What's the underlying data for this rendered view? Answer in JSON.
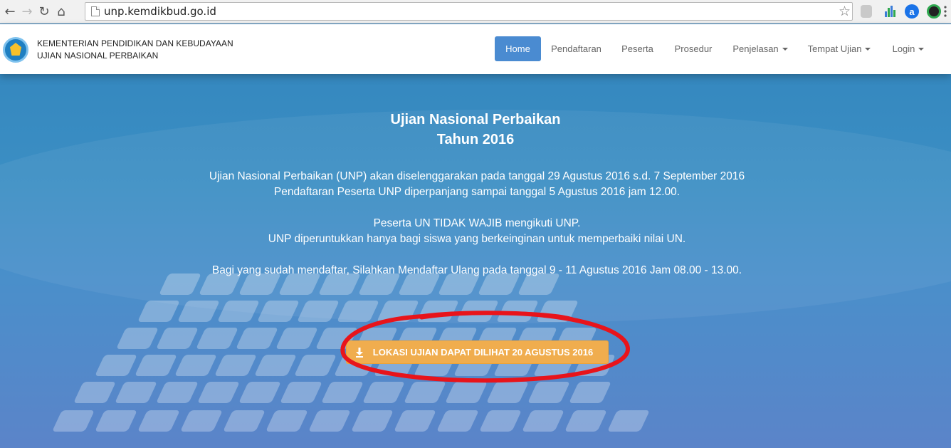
{
  "browser": {
    "url": "unp.kemdikbud.go.id",
    "back_icon": "arrow-left-icon",
    "forward_icon": "arrow-right-icon",
    "reload_icon": "reload-icon",
    "home_icon": "home-icon",
    "bookmark_icon": "star-icon"
  },
  "header": {
    "brand_line1": "KEMENTERIAN PENDIDIKAN DAN KEBUDAYAAN",
    "brand_line2": "UJIAN NASIONAL PERBAIKAN",
    "menu": [
      {
        "label": "Home",
        "active": true,
        "dropdown": false
      },
      {
        "label": "Pendaftaran",
        "active": false,
        "dropdown": false
      },
      {
        "label": "Peserta",
        "active": false,
        "dropdown": false
      },
      {
        "label": "Prosedur",
        "active": false,
        "dropdown": false
      },
      {
        "label": "Penjelasan",
        "active": false,
        "dropdown": true
      },
      {
        "label": "Tempat Ujian",
        "active": false,
        "dropdown": true
      },
      {
        "label": "Login",
        "active": false,
        "dropdown": true
      }
    ]
  },
  "hero": {
    "title_line1": "Ujian Nasional Perbaikan",
    "title_line2": "Tahun 2016",
    "line1": "Ujian Nasional Perbaikan (UNP) akan diselenggarakan pada tanggal 29 Agustus 2016 s.d. 7 September 2016",
    "line2": "Pendaftaran Peserta UNP diperpanjang sampai tanggal 5 Agustus 2016 jam 12.00.",
    "line3": "Peserta UN TIDAK WAJIB mengikuti UNP.",
    "line4": "UNP diperuntukkan hanya bagi siswa yang berkeinginan untuk memperbaiki nilai UN.",
    "line5": "Bagi yang sudah mendaftar, Silahkan Mendaftar Ulang pada tanggal 9 - 11 Agustus 2016 Jam 08.00 - 13.00.",
    "cta_label": "LOKASI UJIAN DAPAT DILIHAT 20 AGUSTUS 2016",
    "cta_icon": "download-icon"
  },
  "colors": {
    "primary": "#4a8bd1",
    "warning": "#f0ad4e",
    "annotation": "#e8141b"
  }
}
